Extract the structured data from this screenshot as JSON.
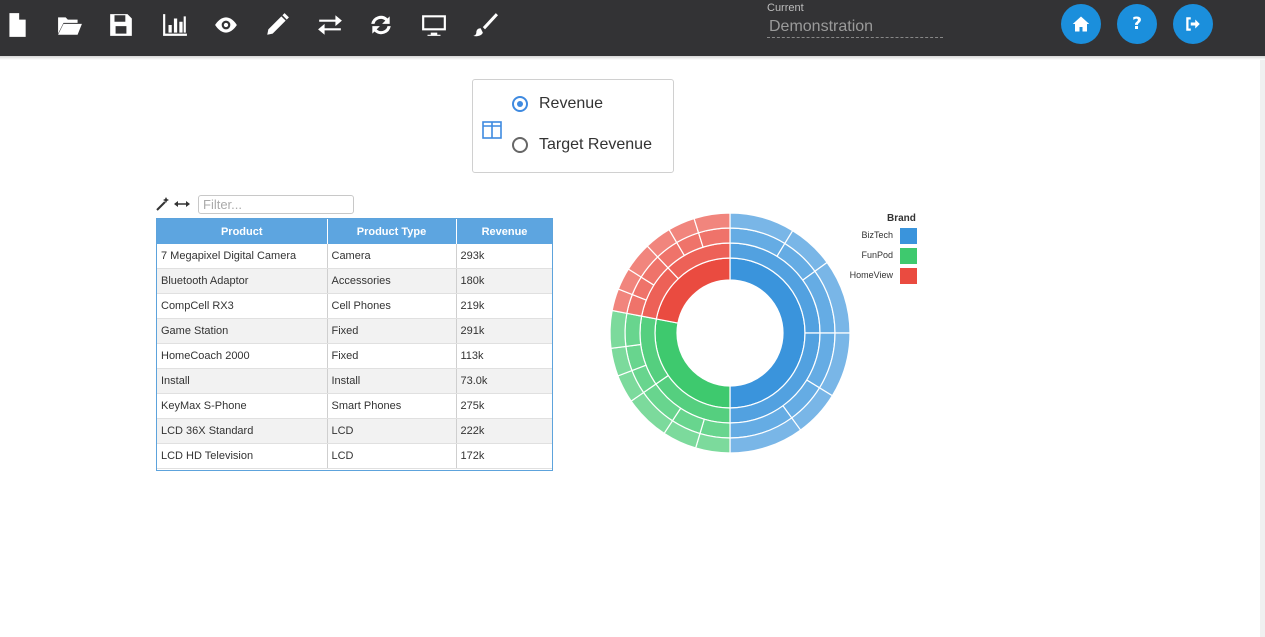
{
  "toolbar": {
    "icons": [
      "new-file-icon",
      "open-folder-icon",
      "save-icon",
      "chart-icon",
      "eye-icon",
      "pencil-icon",
      "exchange-icon",
      "refresh-icon",
      "monitor-icon",
      "paintbrush-icon"
    ],
    "current_label": "Current",
    "current_value": "Demonstration"
  },
  "measures": {
    "option1": "Revenue",
    "option2": "Target Revenue",
    "selected": "Revenue"
  },
  "grid": {
    "filter_placeholder": "Filter...",
    "columns": [
      "Product",
      "Product Type",
      "Revenue"
    ],
    "rows": [
      [
        "7 Megapixel Digital Camera",
        "Camera",
        "293k"
      ],
      [
        "Bluetooth Adaptor",
        "Accessories",
        "180k"
      ],
      [
        "CompCell RX3",
        "Cell Phones",
        "219k"
      ],
      [
        "Game Station",
        "Fixed",
        "291k"
      ],
      [
        "HomeCoach 2000",
        "Fixed",
        "113k"
      ],
      [
        "Install",
        "Install",
        "73.0k"
      ],
      [
        "KeyMax S-Phone",
        "Smart Phones",
        "275k"
      ],
      [
        "LCD 36X Standard",
        "LCD",
        "222k"
      ],
      [
        "LCD HD Television",
        "LCD",
        "172k"
      ]
    ]
  },
  "chart_data": {
    "type": "sunburst",
    "legend_title": "Brand",
    "legend_placement": "top-right",
    "brands": [
      {
        "name": "BizTech",
        "color": "#3a94dc",
        "share": 0.5
      },
      {
        "name": "FunPod",
        "color": "#3ec96e",
        "share": 0.28
      },
      {
        "name": "HomeView",
        "color": "#ea4b40",
        "share": 0.22
      }
    ],
    "ring2_shares": [
      [
        0.5,
        0.5
      ],
      [
        0.55,
        0.45
      ],
      [
        0.45,
        0.55
      ]
    ],
    "ring3_shares": [
      [
        0.35,
        0.25,
        0.4
      ],
      [
        0.3,
        0.3,
        0.4
      ],
      [
        0.3,
        0.3,
        0.4
      ]
    ]
  }
}
